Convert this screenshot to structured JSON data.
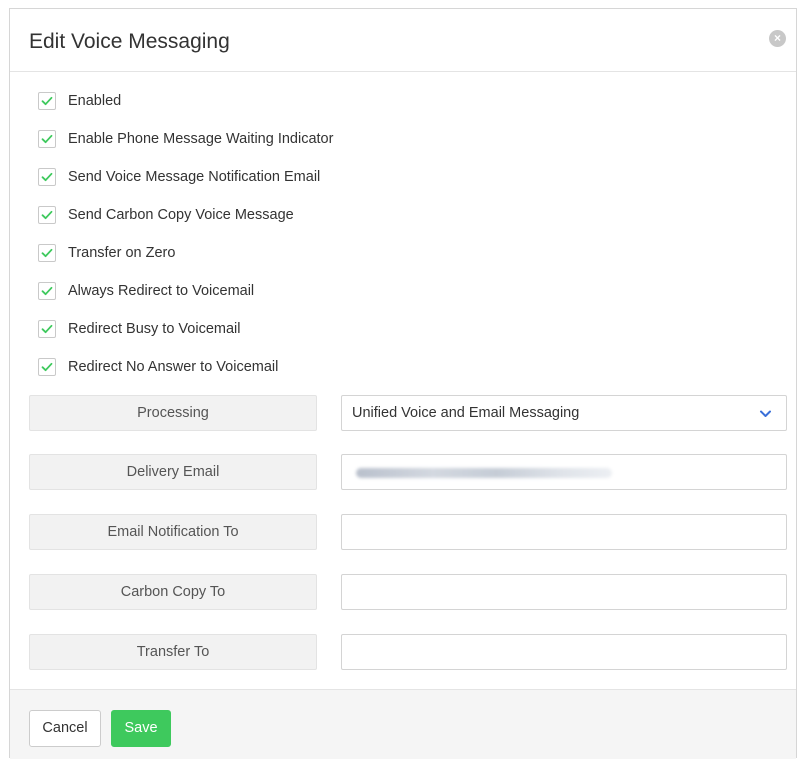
{
  "dialog": {
    "title": "Edit Voice Messaging",
    "close_label": "×"
  },
  "options": [
    {
      "label": "Enabled",
      "checked": true
    },
    {
      "label": "Enable Phone Message Waiting Indicator",
      "checked": true
    },
    {
      "label": "Send Voice Message Notification Email",
      "checked": true
    },
    {
      "label": "Send Carbon Copy Voice Message",
      "checked": true
    },
    {
      "label": "Transfer on Zero",
      "checked": true
    },
    {
      "label": "Always Redirect to Voicemail",
      "checked": true
    },
    {
      "label": "Redirect Busy to Voicemail",
      "checked": true
    },
    {
      "label": "Redirect No Answer to Voicemail",
      "checked": true
    }
  ],
  "fields": {
    "processing": {
      "label": "Processing",
      "value": "Unified Voice and Email Messaging"
    },
    "delivery_email": {
      "label": "Delivery Email",
      "value": ""
    },
    "email_notification_to": {
      "label": "Email Notification To",
      "value": ""
    },
    "carbon_copy_to": {
      "label": "Carbon Copy To",
      "value": ""
    },
    "transfer_to": {
      "label": "Transfer To",
      "value": ""
    }
  },
  "footer": {
    "cancel_label": "Cancel",
    "save_label": "Save"
  },
  "colors": {
    "check_mark": "#3ec95d",
    "save_button": "#3ec95d",
    "chevron": "#3a6fd8"
  },
  "icons": {
    "close": "close-icon",
    "check": "check-icon",
    "select": "chevron-down-icon"
  }
}
